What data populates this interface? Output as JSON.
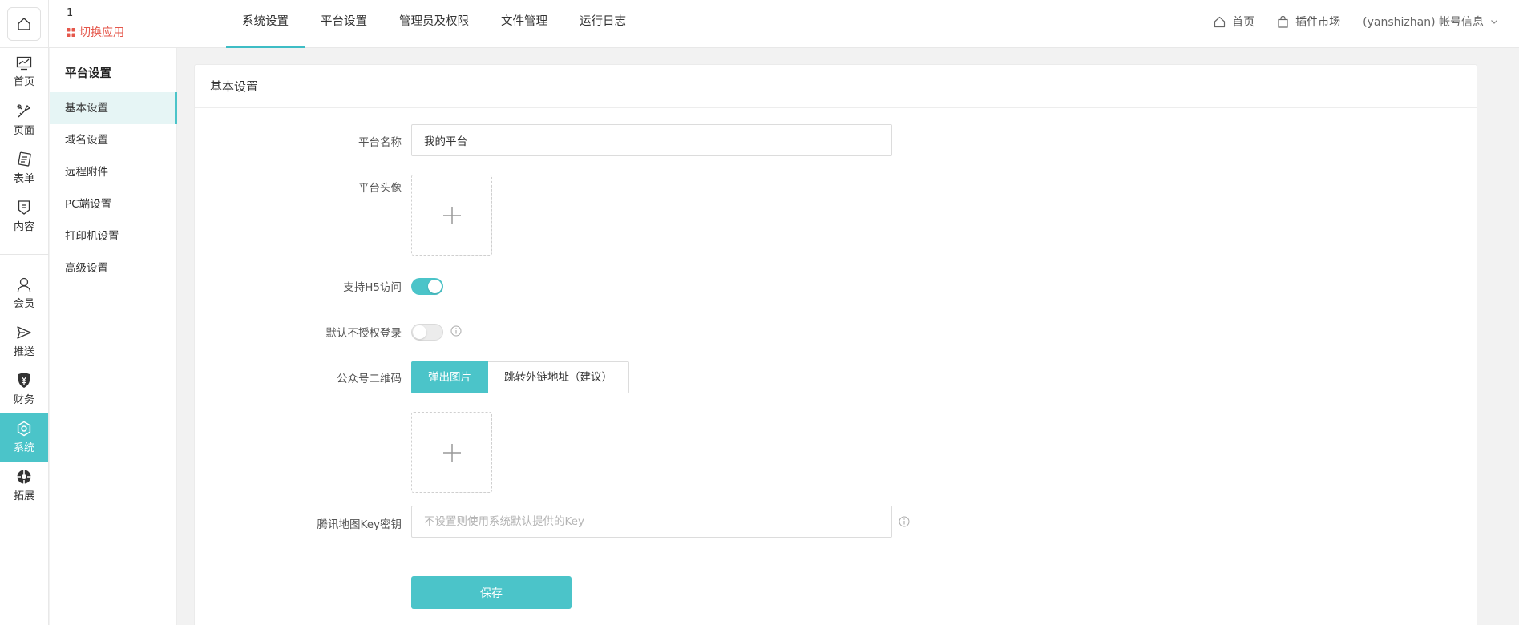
{
  "header": {
    "app_name": "1",
    "switch_app_label": "切换应用",
    "tabs": [
      {
        "label": "系统设置",
        "active": true
      },
      {
        "label": "平台设置",
        "active": false
      },
      {
        "label": "管理员及权限",
        "active": false
      },
      {
        "label": "文件管理",
        "active": false
      },
      {
        "label": "运行日志",
        "active": false
      }
    ],
    "right": {
      "home_label": "首页",
      "plugin_market_label": "插件市场",
      "account_label": "(yanshizhan) 帐号信息"
    }
  },
  "icon_sidebar": {
    "items": [
      {
        "label": "首页",
        "icon": "chart-icon"
      },
      {
        "label": "页面",
        "icon": "brush-icon"
      },
      {
        "label": "表单",
        "icon": "form-icon"
      },
      {
        "label": "内容",
        "icon": "document-icon"
      },
      {
        "label": "会员",
        "icon": "user-icon"
      },
      {
        "label": "推送",
        "icon": "send-icon"
      },
      {
        "label": "财务",
        "icon": "yuan-icon"
      },
      {
        "label": "系统",
        "icon": "settings-icon",
        "active": true
      },
      {
        "label": "拓展",
        "icon": "extension-icon"
      }
    ]
  },
  "sub_sidebar": {
    "title": "平台设置",
    "items": [
      {
        "label": "基本设置",
        "active": true
      },
      {
        "label": "域名设置"
      },
      {
        "label": "远程附件"
      },
      {
        "label": "PC端设置"
      },
      {
        "label": "打印机设置"
      },
      {
        "label": "高级设置"
      }
    ]
  },
  "form": {
    "card_title": "基本设置",
    "platform_name": {
      "label": "平台名称",
      "value": "我的平台"
    },
    "platform_avatar": {
      "label": "平台头像"
    },
    "h5_access": {
      "label": "支持H5访问",
      "enabled": true
    },
    "no_auth_login": {
      "label": "默认不授权登录",
      "enabled": false
    },
    "qrcode": {
      "label": "公众号二维码",
      "options": [
        "弹出图片",
        "跳转外链地址（建议）"
      ],
      "selected": "弹出图片"
    },
    "map_key": {
      "label": "腾讯地图Key密钥",
      "placeholder": "不设置则使用系统默认提供的Key",
      "value": ""
    },
    "save_label": "保存"
  },
  "colors": {
    "accent": "#4bc4c9",
    "switch_app": "#e5574b",
    "active_sub_bg": "#e6f5f5"
  }
}
